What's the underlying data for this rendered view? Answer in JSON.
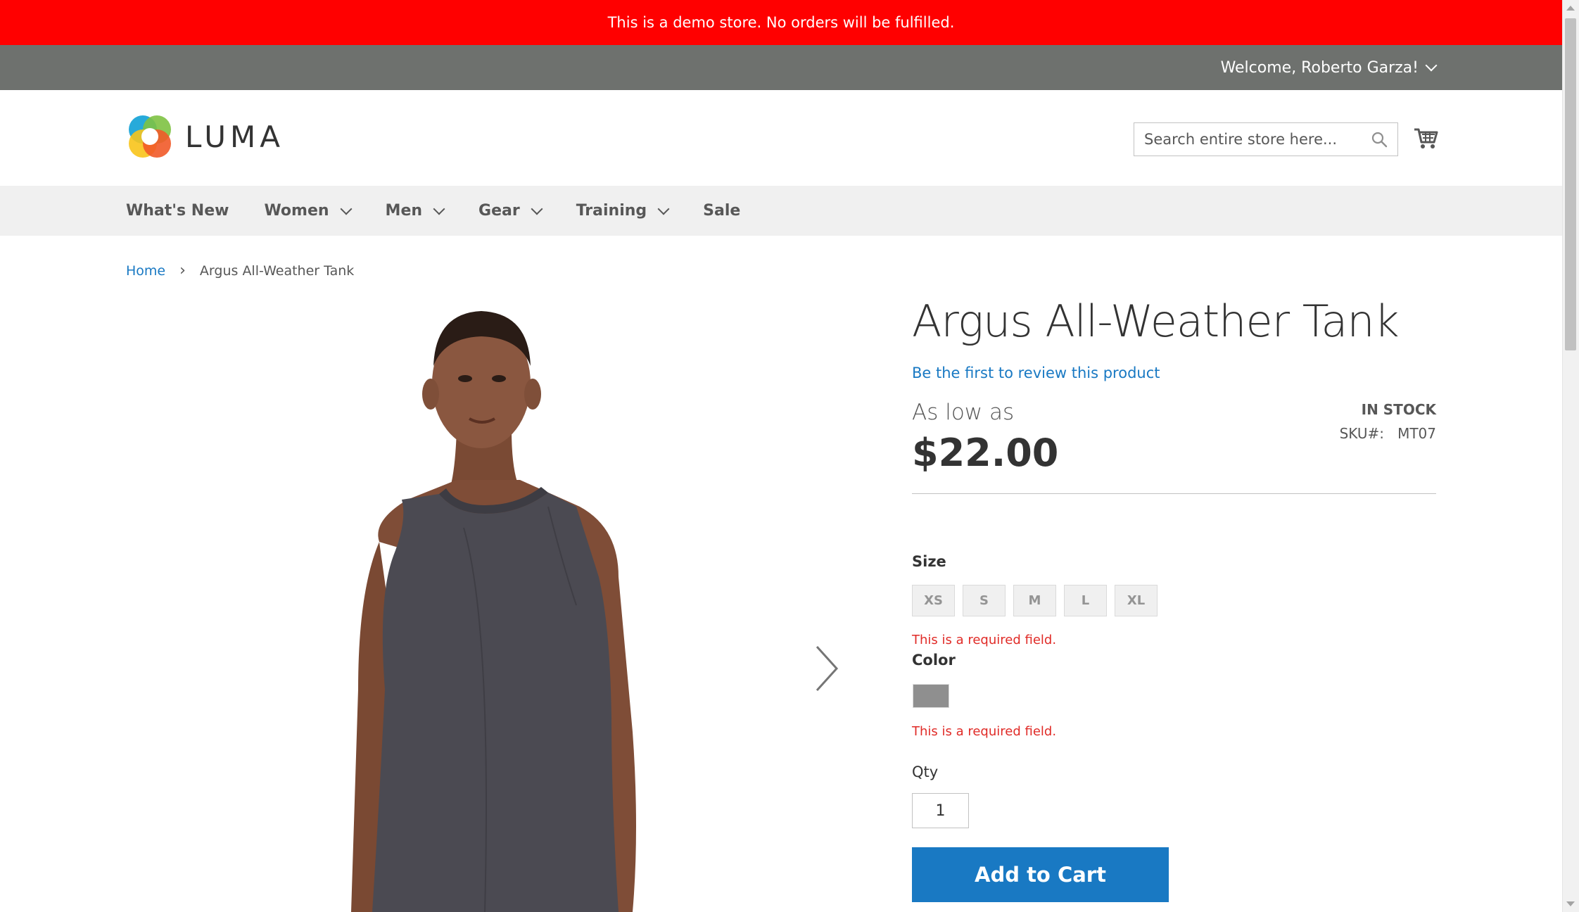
{
  "demo_notice": "This is a demo store. No orders will be fulfilled.",
  "top_bar": {
    "welcome": "Welcome, Roberto Garza!"
  },
  "header": {
    "logo_text": "LUMA",
    "search_placeholder": "Search entire store here..."
  },
  "nav": {
    "items": [
      {
        "label": "What's New",
        "has_dropdown": false
      },
      {
        "label": "Women",
        "has_dropdown": true
      },
      {
        "label": "Men",
        "has_dropdown": true
      },
      {
        "label": "Gear",
        "has_dropdown": true
      },
      {
        "label": "Training",
        "has_dropdown": true
      },
      {
        "label": "Sale",
        "has_dropdown": false
      }
    ]
  },
  "breadcrumbs": {
    "home": "Home",
    "separator": "›",
    "current": "Argus All-Weather Tank"
  },
  "product": {
    "title": "Argus All-Weather Tank",
    "review_link": "Be the first to review this product",
    "price_prefix": "As low as",
    "price": "$22.00",
    "stock": "IN STOCK",
    "sku_label": "SKU#:",
    "sku": "MT07",
    "size_label": "Size",
    "sizes": [
      "XS",
      "S",
      "M",
      "L",
      "XL"
    ],
    "size_error": "This is a required field.",
    "color_label": "Color",
    "color_swatch": "#8f8f8f",
    "color_error": "This is a required field.",
    "qty_label": "Qty",
    "qty_value": "1",
    "add_to_cart": "Add to Cart"
  },
  "colors": {
    "demo_bar": "#ff0000",
    "top_bar": "#6e716e",
    "link": "#1979c3",
    "error": "#e02b27",
    "primary_button": "#1979c3"
  }
}
